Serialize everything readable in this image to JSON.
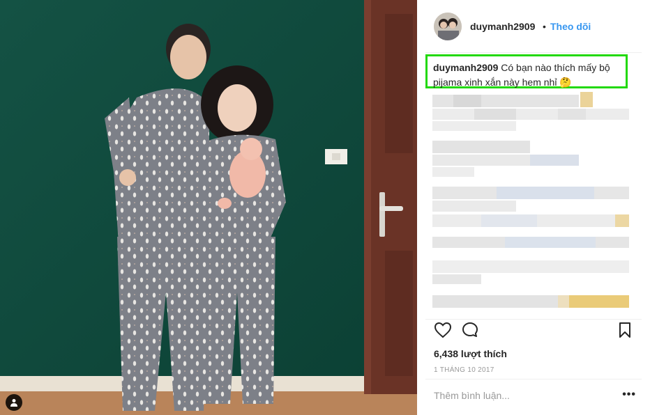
{
  "post": {
    "username": "duymanh2909",
    "separator": "•",
    "follow_label": "Theo dõi",
    "caption_username": "duymanh2909",
    "caption_text": "Có bạn nào thích mấy bộ pijama xinh xắn này hem nhỉ 🤔",
    "likes": "6,438 lượt thích",
    "date": "1 THÁNG 10 2017",
    "comment_placeholder": "Thêm bình luận...",
    "more_label": "•••"
  },
  "icons": {
    "tag": "person-tag-icon",
    "like": "heart-icon",
    "comment": "comment-bubble-icon",
    "save": "bookmark-icon"
  },
  "colors": {
    "follow": "#3897f0",
    "caption_highlight": "#22d90a",
    "wall": "#0f4a3c"
  }
}
